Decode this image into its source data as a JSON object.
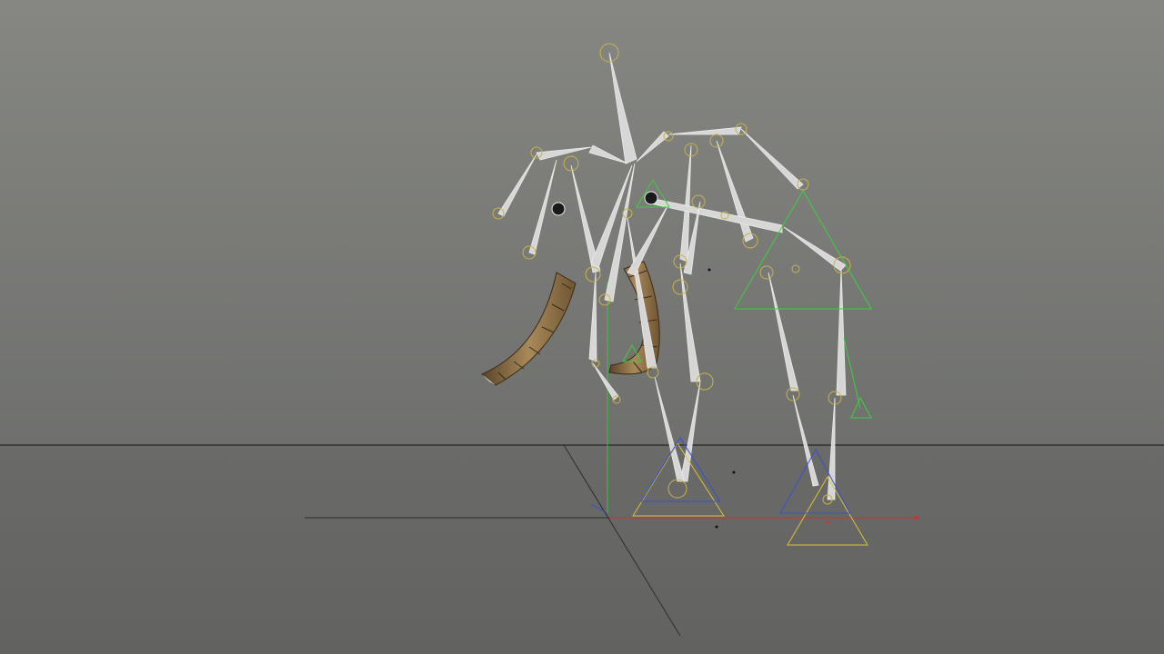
{
  "viewport": {
    "background_top": "#868783",
    "background_horizon": "#6f706d",
    "floor_color": "#6a6a68",
    "floor_bottom": "#626261",
    "horizon_line_color": "#3f3f3f"
  },
  "rig": {
    "bone_fill": "#dcdcdc",
    "bone_edge": "#f2f2f2",
    "joint_color": "#c9b24a",
    "ik_goal_color": "#3ccf3c",
    "foot_control_color": "#d9c23a",
    "foot_control_blue": "#3a50d0",
    "tusk_color": "#8c6f43",
    "tusk_dark": "#4d3920",
    "axis_x_color": "#d23030",
    "axis_y_color": "#40c040",
    "axis_z_color": "#3050d0"
  }
}
